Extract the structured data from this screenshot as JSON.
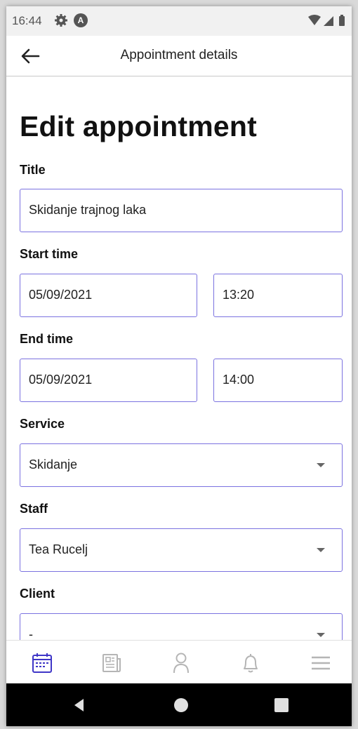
{
  "status_bar": {
    "time": "16:44",
    "badge_letter": "A"
  },
  "app_bar": {
    "title": "Appointment details"
  },
  "form": {
    "heading": "Edit appointment",
    "title_label": "Title",
    "title_value": "Skidanje trajnog laka",
    "start_label": "Start time",
    "start_date": "05/09/2021",
    "start_time": "13:20",
    "end_label": "End time",
    "end_date": "05/09/2021",
    "end_time": "14:00",
    "service_label": "Service",
    "service_value": "Skidanje",
    "staff_label": "Staff",
    "staff_value": "Tea Rucelj",
    "client_label": "Client",
    "client_value": "-"
  },
  "bottom_nav": {
    "items": [
      "calendar-icon",
      "news-icon",
      "person-icon",
      "bell-icon",
      "menu-icon"
    ],
    "active": "calendar-icon"
  },
  "colors": {
    "accent": "#3f36c7",
    "field_border": "#7b72e0",
    "inactive_icon": "#b5b5b5"
  }
}
